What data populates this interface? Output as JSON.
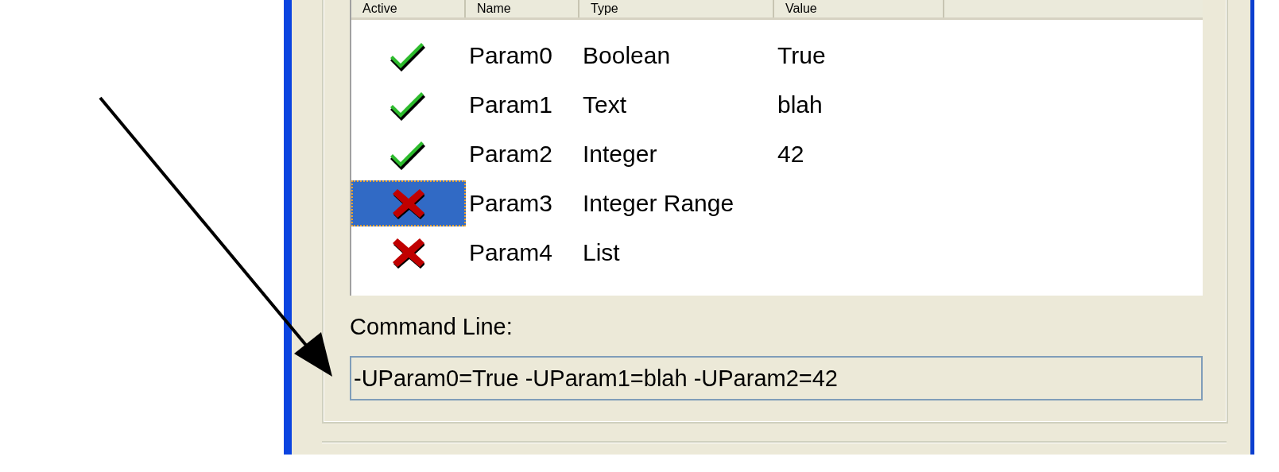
{
  "list": {
    "columns": [
      "Active",
      "Name",
      "Type",
      "Value"
    ],
    "rows": [
      {
        "active": true,
        "selected": false,
        "name": "Param0",
        "type": "Boolean",
        "value": "True"
      },
      {
        "active": true,
        "selected": false,
        "name": "Param1",
        "type": "Text",
        "value": "blah"
      },
      {
        "active": true,
        "selected": false,
        "name": "Param2",
        "type": "Integer",
        "value": "42"
      },
      {
        "active": false,
        "selected": true,
        "name": "Param3",
        "type": "Integer Range"
      },
      {
        "active": false,
        "selected": false,
        "name": "Param4",
        "type": "List"
      }
    ]
  },
  "command_line": {
    "label": "Command Line:",
    "value": "-UParam0=True -UParam1=blah -UParam2=42"
  }
}
